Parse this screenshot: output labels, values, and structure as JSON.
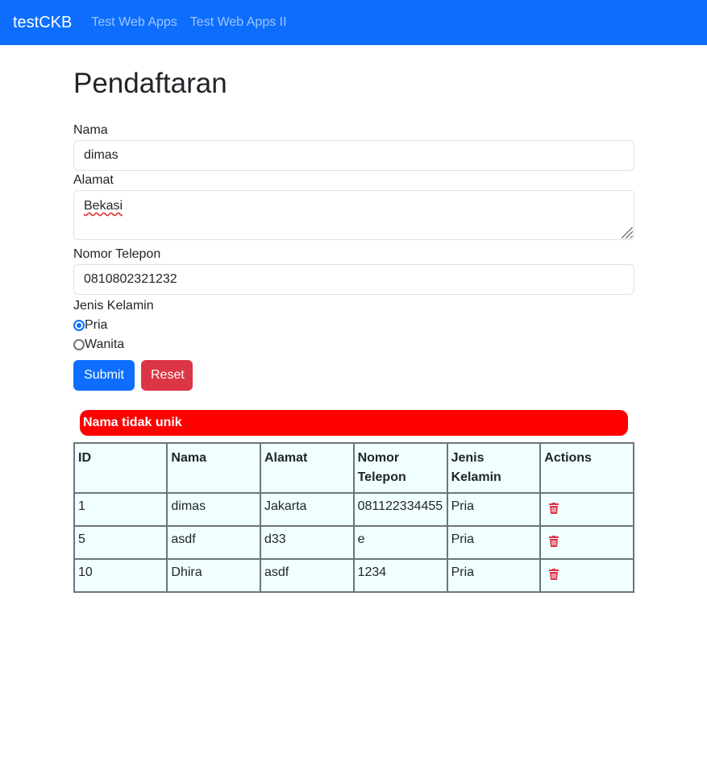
{
  "navbar": {
    "brand": "testCKB",
    "links": [
      "Test Web Apps",
      "Test Web Apps II"
    ]
  },
  "page_title": "Pendaftaran",
  "form": {
    "nama_label": "Nama",
    "nama_value": "dimas",
    "alamat_label": "Alamat",
    "alamat_value": "Bekasi",
    "telepon_label": "Nomor Telepon",
    "telepon_value": "0810802321232",
    "jenis_kelamin_label": "Jenis Kelamin",
    "options": [
      "Pria",
      "Wanita"
    ],
    "selected": "Pria",
    "submit_label": "Submit",
    "reset_label": "Reset"
  },
  "alert": {
    "message": "Nama tidak unik",
    "color": "#ff0000"
  },
  "table": {
    "headers": [
      "ID",
      "Nama",
      "Alamat",
      "Nomor Telepon",
      "Jenis Kelamin",
      "Actions"
    ],
    "rows": [
      [
        "1",
        "dimas",
        "Jakarta",
        "081122334455",
        "Pria"
      ],
      [
        "5",
        "asdf",
        "d33",
        "e",
        "Pria"
      ],
      [
        "10",
        "Dhira",
        "asdf",
        "1234",
        "Pria"
      ]
    ],
    "action_icon": "trash-icon"
  },
  "colors": {
    "primary": "#0d6efd",
    "danger": "#dc3545",
    "table_bg": "#f0ffff"
  }
}
